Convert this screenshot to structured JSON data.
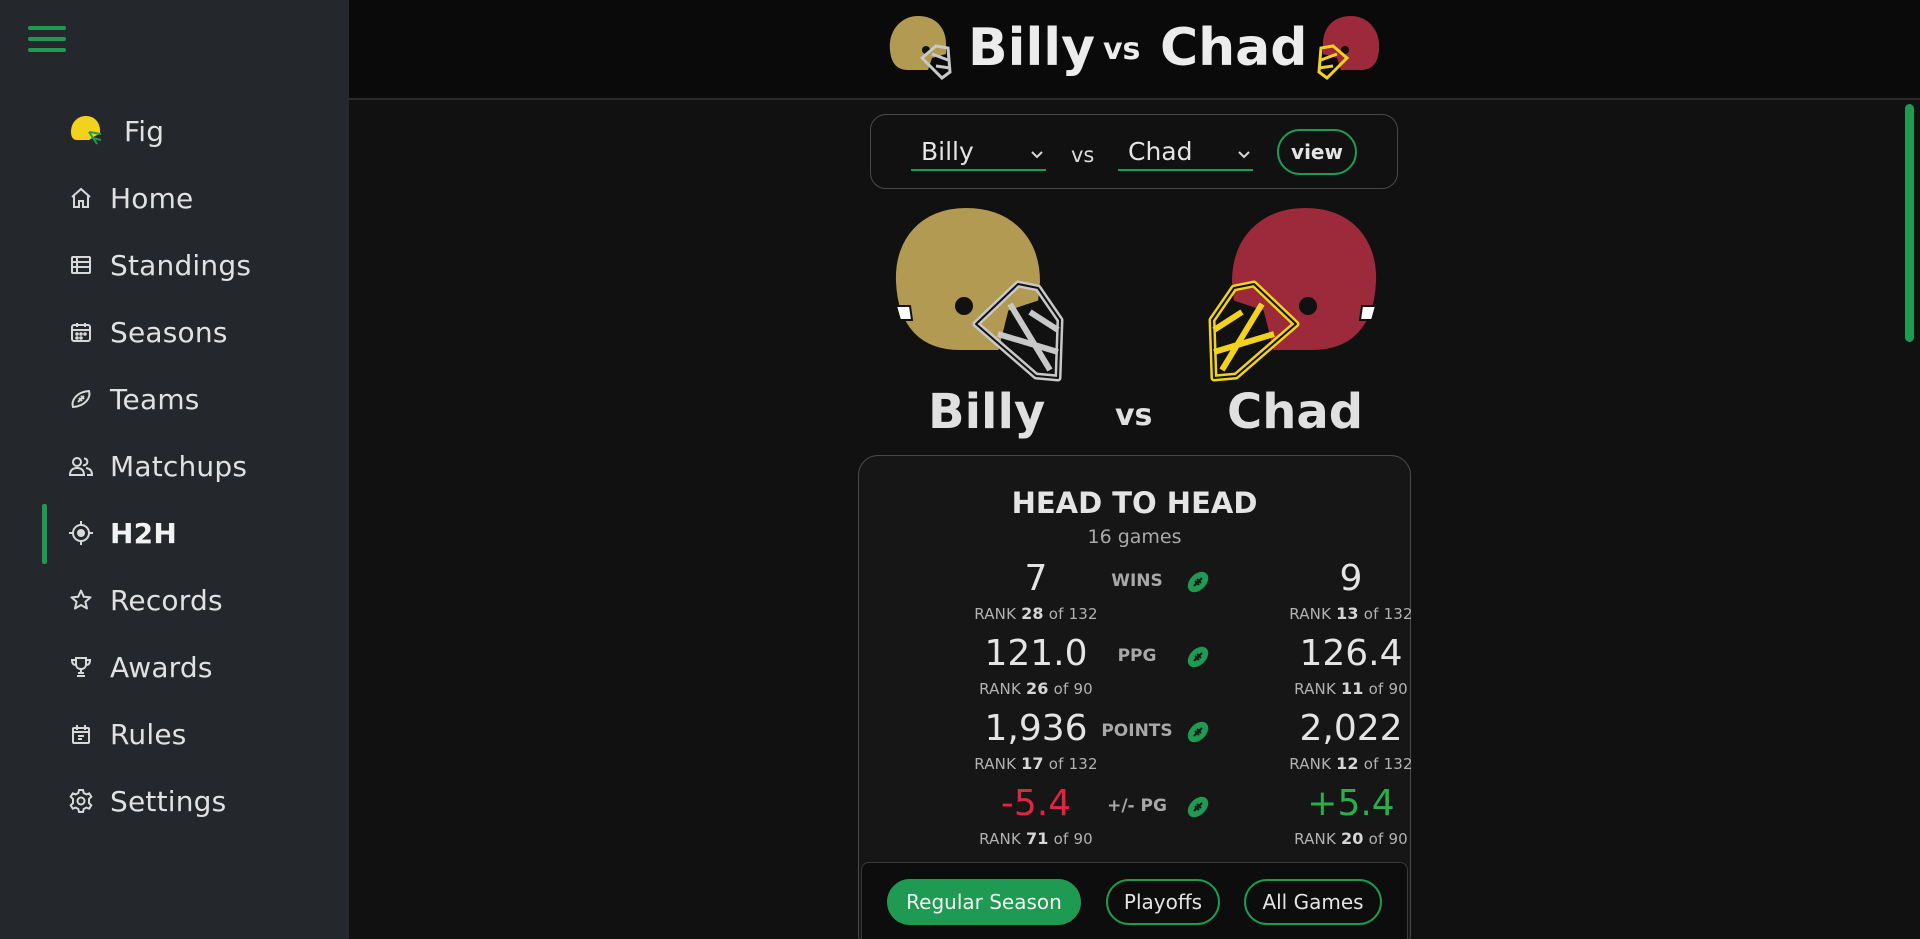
{
  "colors": {
    "accent": "#1e9a52",
    "gold_helmet": "#b39a52",
    "red_helmet": "#9c2a3a",
    "negative": "#e0253f",
    "positive": "#27b04a"
  },
  "sidebar": {
    "menu_icon": "hamburger-icon",
    "items": [
      {
        "label": "Fig",
        "icon": "helmet-icon"
      },
      {
        "label": "Home",
        "icon": "home-icon"
      },
      {
        "label": "Standings",
        "icon": "table-icon"
      },
      {
        "label": "Seasons",
        "icon": "calendar-icon"
      },
      {
        "label": "Teams",
        "icon": "football-icon"
      },
      {
        "label": "Matchups",
        "icon": "people-icon"
      },
      {
        "label": "H2H",
        "icon": "target-icon",
        "active": true
      },
      {
        "label": "Records",
        "icon": "star-icon"
      },
      {
        "label": "Awards",
        "icon": "trophy-icon"
      },
      {
        "label": "Rules",
        "icon": "rules-icon"
      },
      {
        "label": "Settings",
        "icon": "gear-icon"
      }
    ]
  },
  "header": {
    "left_name": "Billy",
    "vs": "vs",
    "right_name": "Chad"
  },
  "selector": {
    "left_value": "Billy",
    "vs": "vs",
    "right_value": "Chad",
    "view_label": "view"
  },
  "matchup": {
    "left_name": "Billy",
    "vs": "vs",
    "right_name": "Chad"
  },
  "h2h": {
    "title": "HEAD TO HEAD",
    "subtitle": "16 games",
    "rows": [
      {
        "label": "WINS",
        "left": {
          "value": "7",
          "rank": "28",
          "of": "132"
        },
        "right": {
          "value": "9",
          "rank": "13",
          "of": "132"
        }
      },
      {
        "label": "PPG",
        "left": {
          "value": "121.0",
          "rank": "26",
          "of": "90"
        },
        "right": {
          "value": "126.4",
          "rank": "11",
          "of": "90"
        }
      },
      {
        "label": "POINTS",
        "left": {
          "value": "1,936",
          "rank": "17",
          "of": "132"
        },
        "right": {
          "value": "2,022",
          "rank": "12",
          "of": "132"
        }
      },
      {
        "label": "+/- PG",
        "left": {
          "value": "-5.4",
          "rank": "71",
          "of": "90"
        },
        "right": {
          "value": "+5.4",
          "rank": "20",
          "of": "90"
        }
      }
    ],
    "rank_word": "RANK",
    "of_word": "of"
  },
  "filters": {
    "regular": "Regular Season",
    "playoffs": "Playoffs",
    "all": "All Games"
  }
}
